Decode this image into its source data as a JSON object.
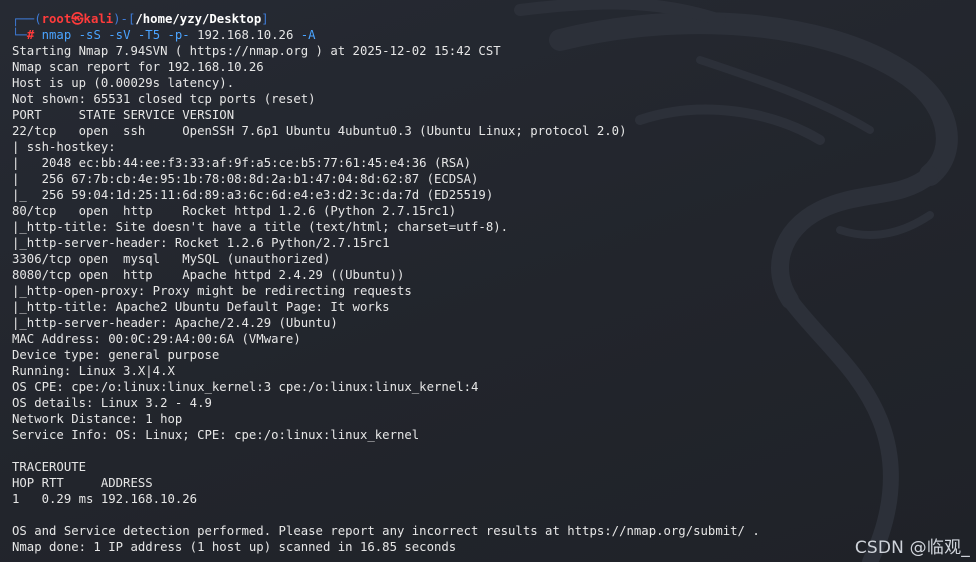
{
  "prompt": {
    "corner_top": "┌──",
    "user": "root㉿kali",
    "path": "/home/yzy/Desktop",
    "corner_bottom": "└─",
    "hash": "#",
    "command": "nmap",
    "flags": "-sS -sV -T5 -p-",
    "target": "192.168.10.26",
    "last_flag": "-A"
  },
  "output_lines": [
    "Starting Nmap 7.94SVN ( https://nmap.org ) at 2025-12-02 15:42 CST",
    "Nmap scan report for 192.168.10.26",
    "Host is up (0.00029s latency).",
    "Not shown: 65531 closed tcp ports (reset)",
    "PORT     STATE SERVICE VERSION",
    "22/tcp   open  ssh     OpenSSH 7.6p1 Ubuntu 4ubuntu0.3 (Ubuntu Linux; protocol 2.0)",
    "| ssh-hostkey: ",
    "|   2048 ec:bb:44:ee:f3:33:af:9f:a5:ce:b5:77:61:45:e4:36 (RSA)",
    "|   256 67:7b:cb:4e:95:1b:78:08:8d:2a:b1:47:04:8d:62:87 (ECDSA)",
    "|_  256 59:04:1d:25:11:6d:89:a3:6c:6d:e4:e3:d2:3c:da:7d (ED25519)",
    "80/tcp   open  http    Rocket httpd 1.2.6 (Python 2.7.15rc1)",
    "|_http-title: Site doesn't have a title (text/html; charset=utf-8).",
    "|_http-server-header: Rocket 1.2.6 Python/2.7.15rc1",
    "3306/tcp open  mysql   MySQL (unauthorized)",
    "8080/tcp open  http    Apache httpd 2.4.29 ((Ubuntu))",
    "|_http-open-proxy: Proxy might be redirecting requests",
    "|_http-title: Apache2 Ubuntu Default Page: It works",
    "|_http-server-header: Apache/2.4.29 (Ubuntu)",
    "MAC Address: 00:0C:29:A4:00:6A (VMware)",
    "Device type: general purpose",
    "Running: Linux 3.X|4.X",
    "OS CPE: cpe:/o:linux:linux_kernel:3 cpe:/o:linux:linux_kernel:4",
    "OS details: Linux 3.2 - 4.9",
    "Network Distance: 1 hop",
    "Service Info: OS: Linux; CPE: cpe:/o:linux:linux_kernel",
    "",
    "TRACEROUTE",
    "HOP RTT     ADDRESS",
    "1   0.29 ms 192.168.10.26",
    "",
    "OS and Service detection performed. Please report any incorrect results at https://nmap.org/submit/ .",
    "Nmap done: 1 IP address (1 host up) scanned in 16.85 seconds"
  ],
  "watermark": "CSDN @临观_",
  "colors": {
    "background": "#23262e",
    "prompt_blue": "#3e7bd6",
    "prompt_red": "#ff3b3b",
    "command_blue": "#4aa3ff",
    "text": "#e6e6e6"
  },
  "background_icon": "kali-dragon-icon"
}
